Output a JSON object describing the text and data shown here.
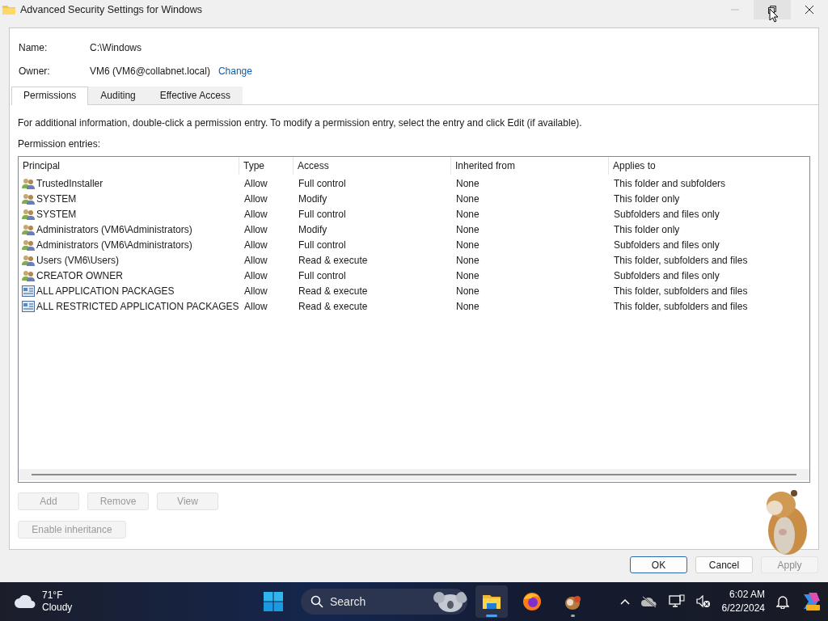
{
  "window": {
    "title": "Advanced Security Settings for Windows"
  },
  "name_field": {
    "label": "Name:",
    "value": "C:\\Windows"
  },
  "owner_field": {
    "label": "Owner:",
    "value": "VM6 (VM6@collabnet.local)",
    "link": "Change"
  },
  "tabs": [
    {
      "label": "Permissions",
      "selected": true
    },
    {
      "label": "Auditing",
      "selected": false
    },
    {
      "label": "Effective Access",
      "selected": false
    }
  ],
  "info_text": "For additional information, double-click a permission entry. To modify a permission entry, select the entry and click Edit (if available).",
  "entries_label": "Permission entries:",
  "table": {
    "columns": [
      "Principal",
      "Type",
      "Access",
      "Inherited from",
      "Applies to"
    ],
    "rows": [
      {
        "kind": "group",
        "principal": "TrustedInstaller",
        "type": "Allow",
        "access": "Full control",
        "inherited_from": "None",
        "applies_to": "This folder and subfolders"
      },
      {
        "kind": "group",
        "principal": "SYSTEM",
        "type": "Allow",
        "access": "Modify",
        "inherited_from": "None",
        "applies_to": "This folder only"
      },
      {
        "kind": "group",
        "principal": "SYSTEM",
        "type": "Allow",
        "access": "Full control",
        "inherited_from": "None",
        "applies_to": "Subfolders and files only"
      },
      {
        "kind": "group",
        "principal": "Administrators (VM6\\Administrators)",
        "type": "Allow",
        "access": "Modify",
        "inherited_from": "None",
        "applies_to": "This folder only"
      },
      {
        "kind": "group",
        "principal": "Administrators (VM6\\Administrators)",
        "type": "Allow",
        "access": "Full control",
        "inherited_from": "None",
        "applies_to": "Subfolders and files only"
      },
      {
        "kind": "group",
        "principal": "Users (VM6\\Users)",
        "type": "Allow",
        "access": "Read & execute",
        "inherited_from": "None",
        "applies_to": "This folder, subfolders and files"
      },
      {
        "kind": "group",
        "principal": "CREATOR OWNER",
        "type": "Allow",
        "access": "Full control",
        "inherited_from": "None",
        "applies_to": "Subfolders and files only"
      },
      {
        "kind": "package",
        "principal": "ALL APPLICATION PACKAGES",
        "type": "Allow",
        "access": "Read & execute",
        "inherited_from": "None",
        "applies_to": "This folder, subfolders and files"
      },
      {
        "kind": "package",
        "principal": "ALL RESTRICTED APPLICATION PACKAGES",
        "type": "Allow",
        "access": "Read & execute",
        "inherited_from": "None",
        "applies_to": "This folder, subfolders and files"
      }
    ]
  },
  "entry_buttons": [
    {
      "label": "Add",
      "disabled": true
    },
    {
      "label": "Remove",
      "disabled": true
    },
    {
      "label": "View",
      "disabled": true
    }
  ],
  "inheritance_button": {
    "label": "Enable inheritance",
    "disabled": true
  },
  "dialog_buttons": [
    {
      "label": "OK",
      "disabled": false,
      "default": true
    },
    {
      "label": "Cancel",
      "disabled": false,
      "default": false
    },
    {
      "label": "Apply",
      "disabled": true,
      "default": false
    }
  ],
  "taskbar": {
    "weather": {
      "temperature": "71°F",
      "condition": "Cloudy"
    },
    "search": {
      "placeholder": "Search"
    },
    "apps": [
      {
        "kind": "explorer",
        "active": true,
        "running": true
      },
      {
        "kind": "firefox",
        "active": false,
        "running": false
      },
      {
        "kind": "pet",
        "active": false,
        "running": true
      }
    ],
    "clock": {
      "time": "6:02 AM",
      "date": "6/22/2024"
    }
  }
}
